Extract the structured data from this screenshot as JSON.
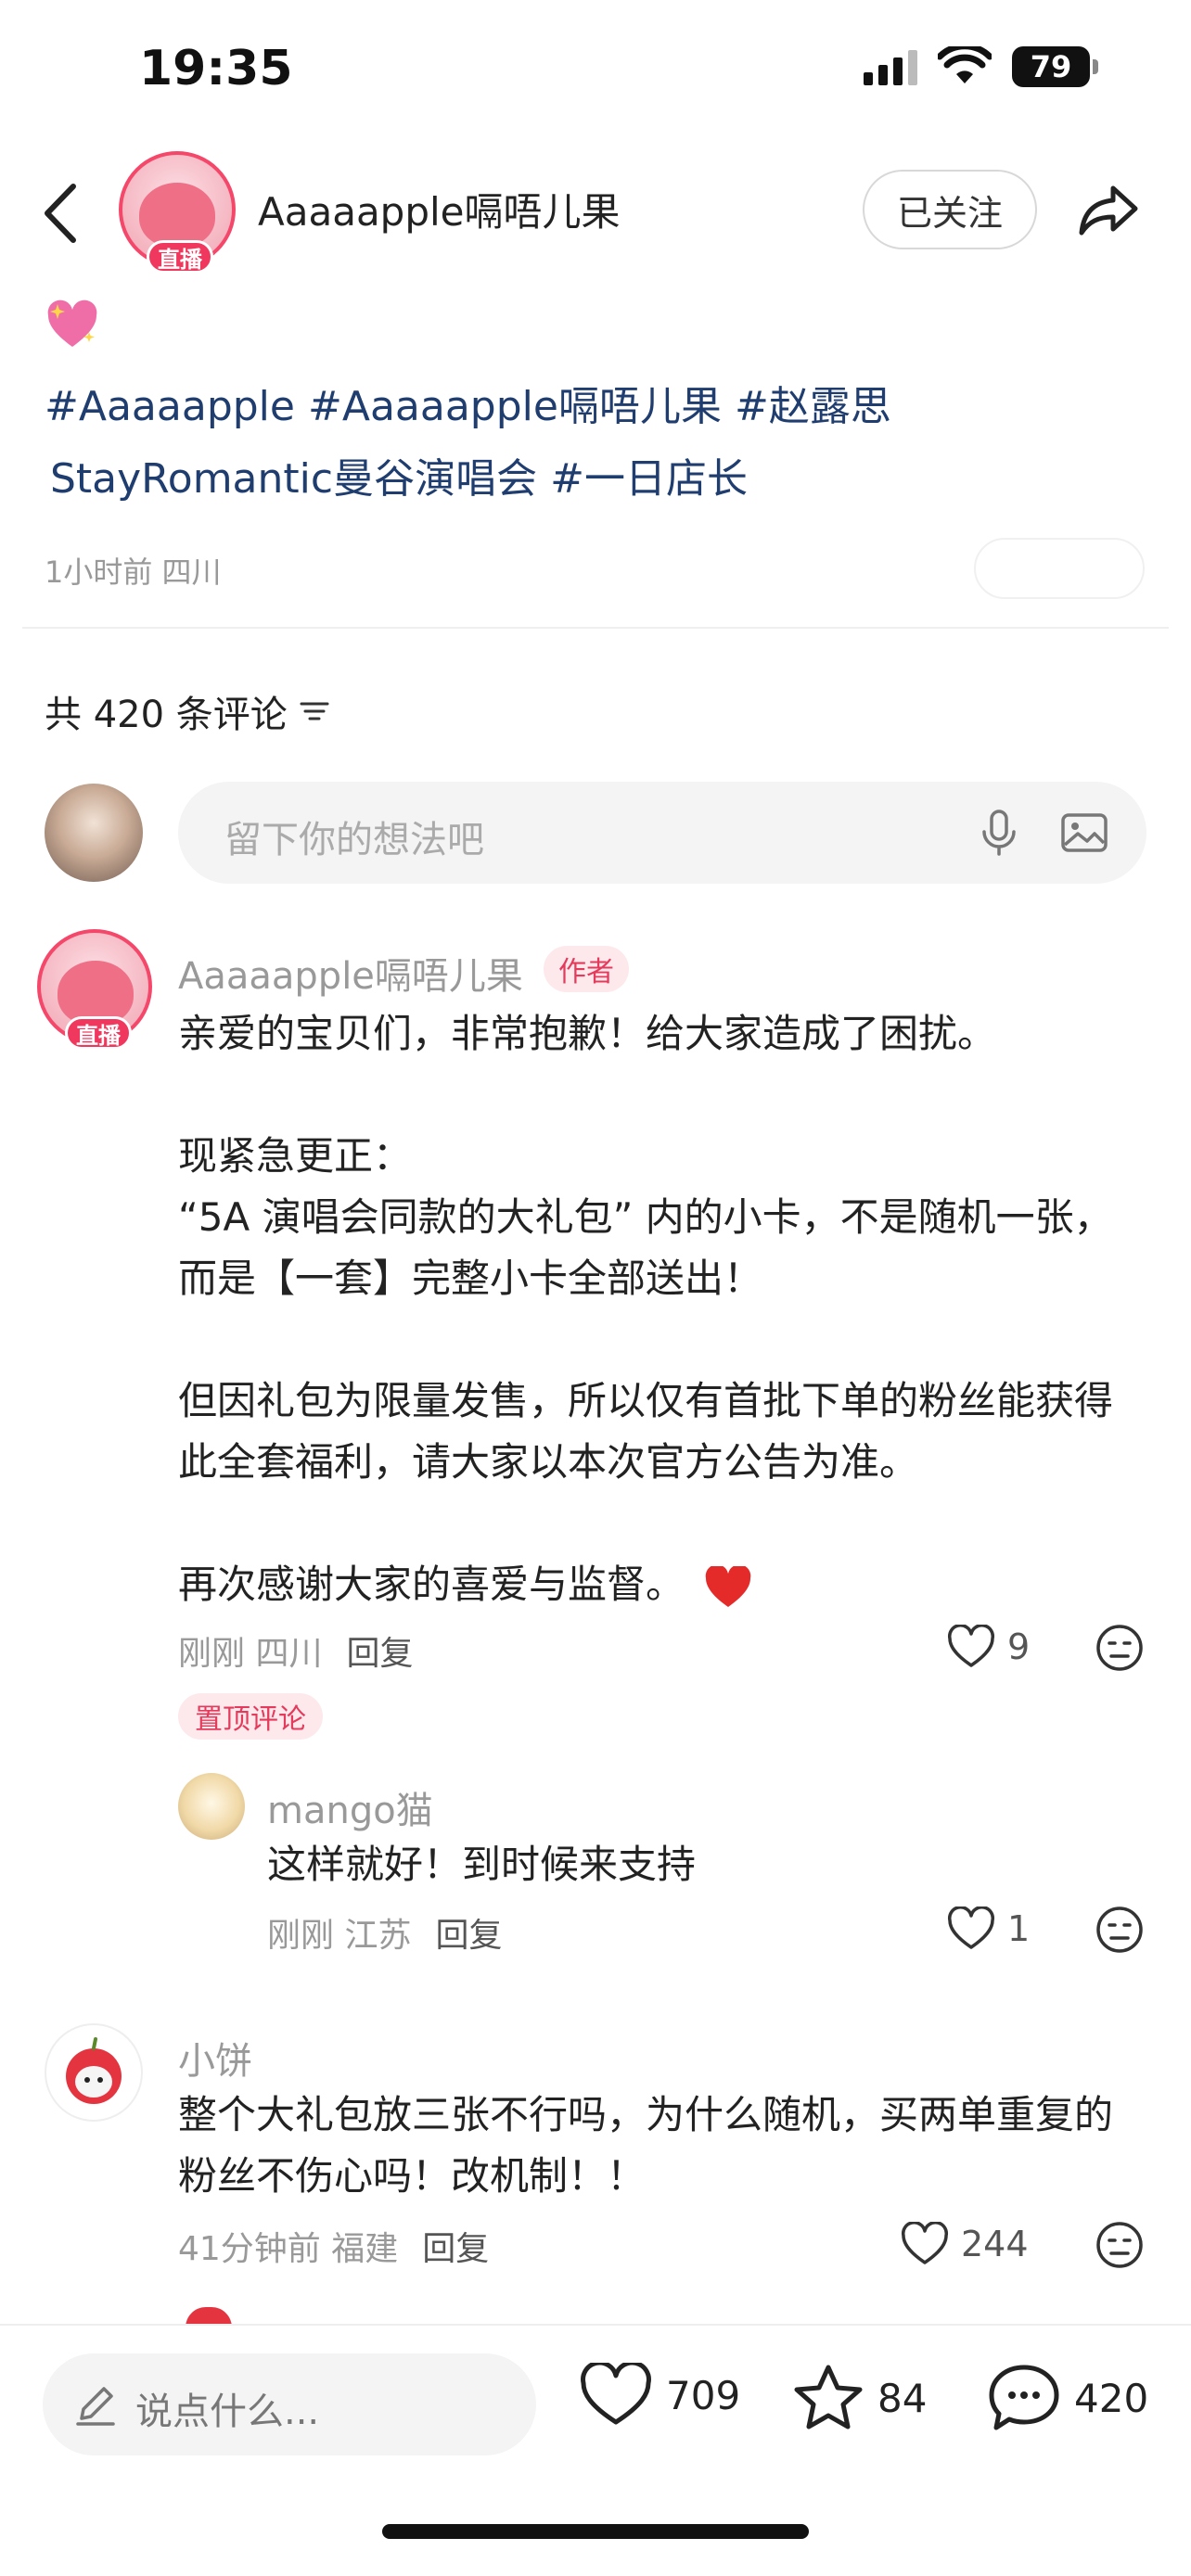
{
  "status_bar": {
    "time": "19:35",
    "battery": "79"
  },
  "header": {
    "author_name": "Aaaaapple嗝唔儿果",
    "live_label": "直播",
    "follow_label": "已关注"
  },
  "post": {
    "tags_line1": [
      "#Aaaaapple",
      "#Aaaaapple嗝唔儿果",
      "#赵露思"
    ],
    "tags_line2": [
      "StayRomantic曼谷演唱会",
      "#一日店长"
    ],
    "meta": "1小时前 四川"
  },
  "comments_header": {
    "count_label": "共 420 条评论"
  },
  "comment_input": {
    "placeholder": "留下你的想法吧"
  },
  "comments": [
    {
      "name": "Aaaaapple嗝唔儿果",
      "tag": "作者",
      "live_label": "直播",
      "lines": [
        "亲爱的宝贝们，非常抱歉！给大家造成了困扰。",
        "现紧急更正：",
        "“5A 演唱会同款的大礼包” 内的小卡，不是随机一张，",
        "而是【一套】完整小卡全部送出！",
        "但因礼包为限量发售，所以仅有首批下单的粉丝能获得",
        "此全套福利，请大家以本次官方公告为准。",
        "再次感谢大家的喜爱与监督。"
      ],
      "meta": "刚刚 四川",
      "reply_label": "回复",
      "likes": "9",
      "pinned_label": "置顶评论"
    },
    {
      "name": "mango猫",
      "text": "这样就好！到时候来支持",
      "meta": "刚刚 江苏",
      "reply_label": "回复",
      "likes": "1"
    },
    {
      "name": "小饼",
      "lines": [
        "整个大礼包放三张不行吗，为什么随机，买两单重复的",
        "粉丝不伤心吗！改机制！！"
      ],
      "meta": "41分钟前 福建",
      "reply_label": "回复",
      "likes": "244"
    }
  ],
  "bottom_bar": {
    "say_placeholder": "说点什么...",
    "likes": "709",
    "stars": "84",
    "comments": "420"
  },
  "colors": {
    "accent": "#f0375d",
    "tag_text": "#1f3d6e",
    "meta": "#999999"
  }
}
